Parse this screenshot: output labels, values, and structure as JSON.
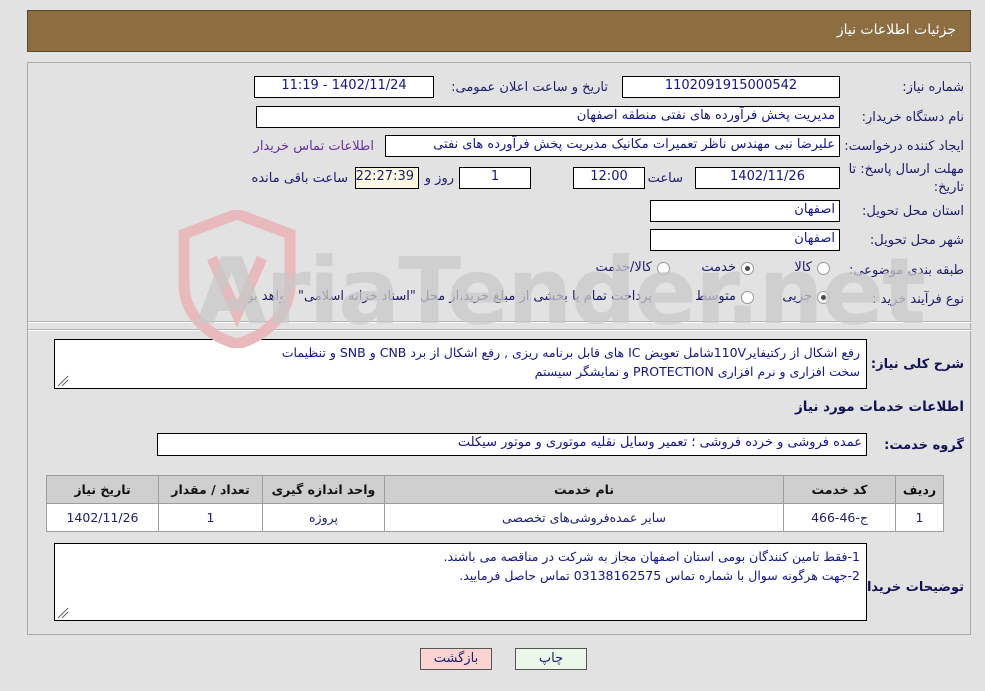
{
  "header": {
    "title": "جزئیات اطلاعات نیاز"
  },
  "colors": {
    "header_bar": "#8d6e43",
    "page_bg": "#e2e2e2",
    "field_text": "#15158a",
    "link": "#6a2fa0",
    "countdown_bg": "#fbf8e3",
    "print_btn_bg": "#eaf7e9",
    "back_btn_bg": "#fbd3d3",
    "table_header_bg": "#cfcfcf"
  },
  "form": {
    "need_number_label": "شماره نیاز:",
    "need_number_value": "1102091915000542",
    "public_announce_label": "تاریخ و ساعت اعلان عمومی:",
    "public_announce_value": "1402/11/24 - 11:19",
    "buyer_org_label": "نام دستگاه خریدار:",
    "buyer_org_value": "مدیریت پخش فرآورده های نفتی منطقه اصفهان",
    "requester_label": "ایجاد کننده درخواست:",
    "requester_value": "علیرضا نبی مهندس ناظر تعمیرات مکانیک مدیریت پخش فرآورده های نفتی",
    "buyer_contact_link": "اطلاعات تماس خریدار",
    "deadline_label_line1": "مهلت ارسال پاسخ: تا",
    "deadline_label_line2": "تاریخ:",
    "deadline_date": "1402/11/26",
    "hour_label": "ساعت",
    "deadline_time": "12:00",
    "days_value": "1",
    "days_label": "روز و",
    "countdown_value": "22:27:39",
    "countdown_label": "ساعت باقی مانده",
    "province_label": "استان محل تحویل:",
    "province_value": "اصفهان",
    "city_label": "شهر محل تحویل:",
    "city_value": "اصفهان",
    "category_label": "طبقه بندی موضوعی:",
    "category_options": [
      {
        "label": "کالا",
        "selected": false
      },
      {
        "label": "خدمت",
        "selected": true
      },
      {
        "label": "کالا/خدمت",
        "selected": false
      }
    ],
    "purchase_type_label": "نوع فرآیند خرید :",
    "purchase_type_options": [
      {
        "label": "جزیی",
        "selected": true
      },
      {
        "label": "متوسط",
        "selected": false
      }
    ],
    "purchase_note": "پرداخت تمام یا بخشی از مبلغ خرید،از محل \"اسناد خزانه اسلامی\" خواهد بود."
  },
  "description": {
    "label": "شرح کلی نیاز:",
    "line1": "رفع اشکال از رکتیفایر110Vشامل تعویض IC های قابل برنامه ریزی , رفع اشکال از برد CNB و SNB و تنظیمات",
    "line2": "سخت افزاری و نرم افزاری PROTECTION و نمایشگر سیستم"
  },
  "services_section": {
    "title": "اطلاعات خدمات مورد نیاز",
    "group_label": "گروه خدمت:",
    "group_value": "عمده فروشی و خرده فروشی ؛ تعمیر وسایل نقلیه موتوری و موتور سیکلت"
  },
  "table": {
    "headers": [
      "ردیف",
      "کد خدمت",
      "نام خدمت",
      "واحد اندازه گیری",
      "تعداد / مقدار",
      "تاریخ نیاز"
    ],
    "rows": [
      {
        "row_no": "1",
        "service_code": "ج-46-466",
        "service_name": "سایر عمده‌فروشی‌های تخصصی",
        "unit": "پروژه",
        "quantity": "1",
        "need_date": "1402/11/26"
      }
    ]
  },
  "buyer_notes": {
    "label": "توضیحات خریدار:",
    "line1": "1-فقط تامین کنندگان بومی استان اصفهان مجاز به شرکت در مناقصه می باشند.",
    "line2": "2-جهت هرگونه سوال با شماره تماس 03138162575 تماس حاصل فرمایید."
  },
  "buttons": {
    "print": "چاپ",
    "back": "بازگشت"
  },
  "watermark": {
    "text": "AriaTender.net"
  }
}
